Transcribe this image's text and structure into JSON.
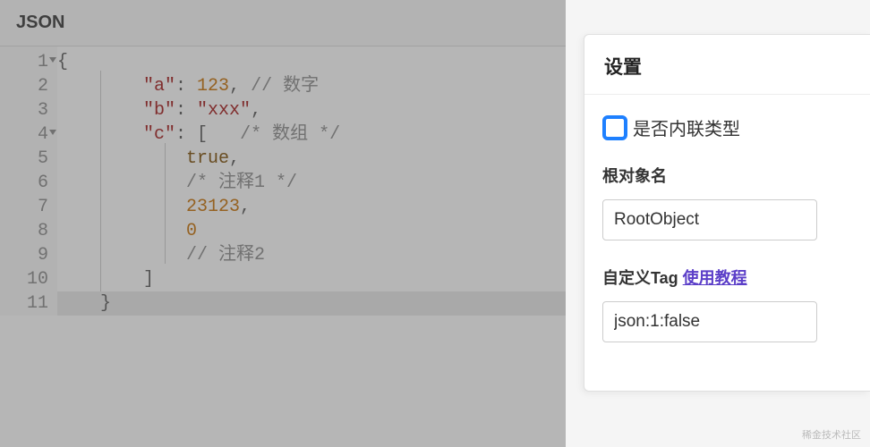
{
  "editor": {
    "title": "JSON",
    "lines": [
      {
        "num": "1",
        "fold": true,
        "segs": [
          [
            "{",
            "brace"
          ]
        ]
      },
      {
        "num": "2",
        "segs": [
          [
            "        ",
            ""
          ],
          [
            "\"a\"",
            "key"
          ],
          [
            ": ",
            "punc"
          ],
          [
            "123",
            "num"
          ],
          [
            ", ",
            "punc"
          ],
          [
            "// 数字",
            "comment"
          ]
        ]
      },
      {
        "num": "3",
        "segs": [
          [
            "        ",
            ""
          ],
          [
            "\"b\"",
            "key"
          ],
          [
            ": ",
            "punc"
          ],
          [
            "\"xxx\"",
            "str"
          ],
          [
            ",",
            "punc"
          ]
        ]
      },
      {
        "num": "4",
        "fold": true,
        "segs": [
          [
            "        ",
            ""
          ],
          [
            "\"c\"",
            "key"
          ],
          [
            ": ",
            "punc"
          ],
          [
            "[",
            "brace"
          ],
          [
            "   ",
            ""
          ],
          [
            "/* 数组 */",
            "comment"
          ]
        ]
      },
      {
        "num": "5",
        "segs": [
          [
            "            ",
            ""
          ],
          [
            "true",
            "bool"
          ],
          [
            ",",
            "punc"
          ]
        ]
      },
      {
        "num": "6",
        "segs": [
          [
            "            ",
            ""
          ],
          [
            "/* 注释1 */",
            "comment"
          ]
        ]
      },
      {
        "num": "7",
        "segs": [
          [
            "            ",
            ""
          ],
          [
            "23123",
            "num"
          ],
          [
            ",",
            "punc"
          ]
        ]
      },
      {
        "num": "8",
        "segs": [
          [
            "            ",
            ""
          ],
          [
            "0",
            "num"
          ]
        ]
      },
      {
        "num": "9",
        "segs": [
          [
            "            ",
            ""
          ],
          [
            "// 注释2",
            "comment"
          ]
        ]
      },
      {
        "num": "10",
        "segs": [
          [
            "        ",
            ""
          ],
          [
            "]",
            "brace"
          ]
        ]
      },
      {
        "num": "11",
        "hl": true,
        "segs": [
          [
            "    ",
            ""
          ],
          [
            "}",
            "brace"
          ]
        ]
      }
    ]
  },
  "settings": {
    "title": "设置",
    "inline_checkbox_label": "是否内联类型",
    "root_name_label": "根对象名",
    "root_name_value": "RootObject",
    "tag_label_prefix": "自定义Tag ",
    "tag_link_text": "使用教程",
    "tag_value": "json:1:false"
  },
  "watermark": "稀金技术社区"
}
